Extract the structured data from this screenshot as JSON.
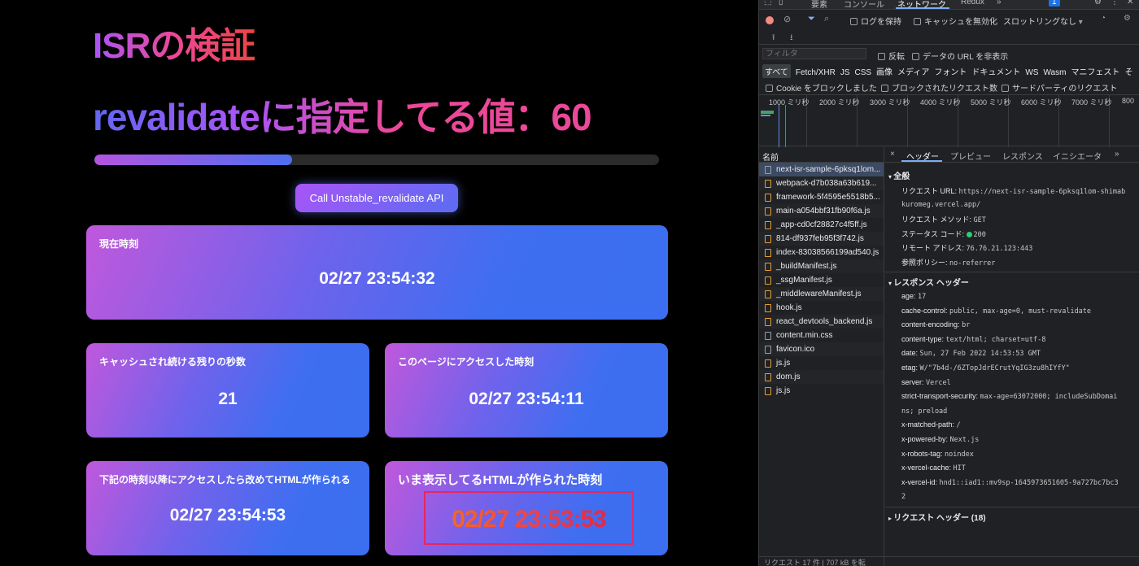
{
  "app": {
    "title": "ISRの検証",
    "revalidate_heading": "revalidateに指定してる値：60",
    "progress": 0.35,
    "api_button": "Call Unstable_revalidate API",
    "cards": {
      "now": {
        "label": "現在時刻",
        "value": "02/27 23:54:32"
      },
      "remaining": {
        "label": "キャッシュされ続ける残りの秒数",
        "value": "21"
      },
      "accessed": {
        "label": "このページにアクセスした時刻",
        "value": "02/27 23:54:11"
      },
      "next": {
        "label": "下記の時刻以降にアクセスしたら改めてHTMLが作られる",
        "value": "02/27 23:54:53"
      },
      "generated": {
        "label": "いま表示してるHTMLが作られた時刻",
        "value": "02/27 23:53:53"
      }
    }
  },
  "devtools": {
    "tabs": [
      "要素",
      "コンソール",
      "ネットワーク",
      "Redux",
      "»"
    ],
    "badge": "1",
    "toolbar": {
      "preserve_log": "ログを保持",
      "disable_cache": "キャッシュを無効化",
      "throttle": "スロットリングなし"
    },
    "filter_placeholder": "フィルタ",
    "invert": "反転",
    "hide_data_urls": "データの URL を非表示",
    "types": [
      "すべて",
      "Fetch/XHR",
      "JS",
      "CSS",
      "画像",
      "メディア",
      "フォント",
      "ドキュメント",
      "WS",
      "Wasm",
      "マニフェスト",
      "そ"
    ],
    "blocked_cookies": "Cookie をブロックしました",
    "blocked_requests": "ブロックされたリクエスト数",
    "third_party": "サードパーティのリクエスト",
    "timeline_ticks": [
      "1000 ミリ秒",
      "2000 ミリ秒",
      "3000 ミリ秒",
      "4000 ミリ秒",
      "5000 ミリ秒",
      "6000 ミリ秒",
      "7000 ミリ秒",
      "800"
    ],
    "name_header": "名前",
    "requests": [
      {
        "name": "next-isr-sample-6pksq1lom...",
        "type": "doc"
      },
      {
        "name": "webpack-d7b038a63b619...",
        "type": "js"
      },
      {
        "name": "framework-5f4595e5518b5...",
        "type": "js"
      },
      {
        "name": "main-a054bbf31fb90f6a.js",
        "type": "js"
      },
      {
        "name": "_app-cd0cf28827c4f5ff.js",
        "type": "js"
      },
      {
        "name": "814-df937feb95f3f742.js",
        "type": "js"
      },
      {
        "name": "index-83038566199ad540.js",
        "type": "js"
      },
      {
        "name": "_buildManifest.js",
        "type": "js"
      },
      {
        "name": "_ssgManifest.js",
        "type": "js"
      },
      {
        "name": "_middlewareManifest.js",
        "type": "js"
      },
      {
        "name": "hook.js",
        "type": "js"
      },
      {
        "name": "react_devtools_backend.js",
        "type": "js"
      },
      {
        "name": "content.min.css",
        "type": "doc"
      },
      {
        "name": "favicon.ico",
        "type": "doc"
      },
      {
        "name": "js.js",
        "type": "js"
      },
      {
        "name": "dom.js",
        "type": "js"
      },
      {
        "name": "js.js",
        "type": "js"
      }
    ],
    "footer": "リクエスト 17 件  |  707 kB を転",
    "detail_tabs": [
      "×",
      "ヘッダー",
      "プレビュー",
      "レスポンス",
      "イニシエータ",
      "»"
    ],
    "general_title": "全般",
    "general": [
      {
        "k": "リクエスト URL:",
        "v": "https://next-isr-sample-6pksq1lom-shimab"
      },
      {
        "k": "",
        "v": "kuromeg.vercel.app/"
      },
      {
        "k": "リクエスト メソッド:",
        "v": "GET"
      },
      {
        "k": "ステータス コード:",
        "v": "200"
      },
      {
        "k": "リモート アドレス:",
        "v": "76.76.21.123:443"
      },
      {
        "k": "参照ポリシー:",
        "v": "no-referrer"
      }
    ],
    "response_title": "レスポンス ヘッダー",
    "response": [
      {
        "k": "age:",
        "v": "17"
      },
      {
        "k": "cache-control:",
        "v": "public, max-age=0, must-revalidate"
      },
      {
        "k": "content-encoding:",
        "v": "br"
      },
      {
        "k": "content-type:",
        "v": "text/html; charset=utf-8"
      },
      {
        "k": "date:",
        "v": "Sun, 27 Feb 2022 14:53:53 GMT"
      },
      {
        "k": "etag:",
        "v": "W/\"7b4d-/6ZTopJdrECrutYqIG3zu8hIYfY\""
      },
      {
        "k": "server:",
        "v": "Vercel"
      },
      {
        "k": "strict-transport-security:",
        "v": "max-age=63072000; includeSubDomai"
      },
      {
        "k": "",
        "v": "ns; preload"
      },
      {
        "k": "x-matched-path:",
        "v": "/"
      },
      {
        "k": "x-powered-by:",
        "v": "Next.js"
      },
      {
        "k": "x-robots-tag:",
        "v": "noindex"
      },
      {
        "k": "x-vercel-cache:",
        "v": "HIT"
      },
      {
        "k": "x-vercel-id:",
        "v": "hnd1::iad1::mv9sp-1645973651605-9a727bc7bc3"
      },
      {
        "k": "",
        "v": "2"
      }
    ],
    "request_headers_title": "リクエスト ヘッダー (18)"
  }
}
